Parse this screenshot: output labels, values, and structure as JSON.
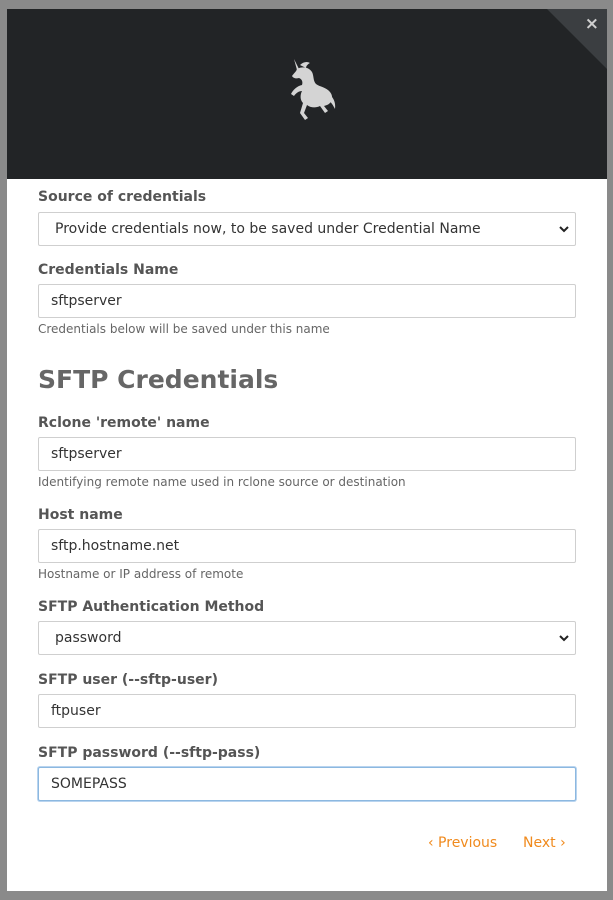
{
  "modal": {
    "close_label": "×"
  },
  "form": {
    "source_label": "Source of credentials",
    "source_value": "Provide credentials now, to be saved under Credential Name",
    "cred_name_label": "Credentials Name",
    "cred_name_value": "sftpserver",
    "cred_name_help": "Credentials below will be saved under this name",
    "section_title": "SFTP Credentials",
    "remote_label": "Rclone 'remote' name",
    "remote_value": "sftpserver",
    "remote_help": "Identifying remote name used in rclone source or destination",
    "host_label": "Host name",
    "host_value": "sftp.hostname.net",
    "host_help": "Hostname or IP address of remote",
    "auth_label": "SFTP Authentication Method",
    "auth_value": "password",
    "user_label": "SFTP user (--sftp-user)",
    "user_value": "ftpuser",
    "pass_label": "SFTP password (--sftp-pass)",
    "pass_value": "SOMEPASS"
  },
  "nav": {
    "previous": "‹ Previous",
    "next": "Next ›"
  },
  "colors": {
    "header_bg": "#222426",
    "link": "#f08a1d",
    "focus_border": "#8cb8e0"
  },
  "icons": {
    "logo": "unicorn-logo-icon",
    "close": "close-icon",
    "select_arrow": "chevron-down-icon"
  }
}
